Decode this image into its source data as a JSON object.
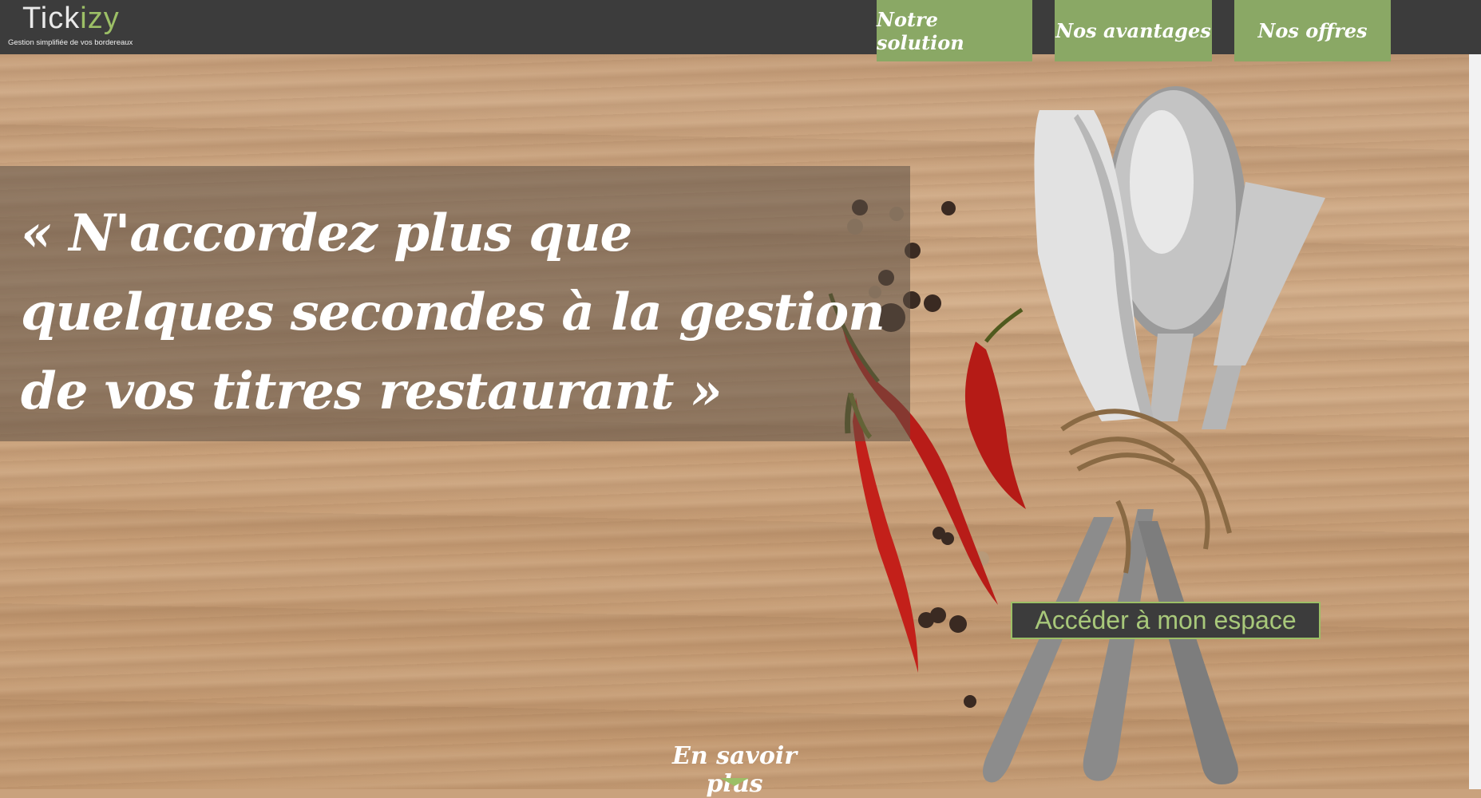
{
  "header": {
    "logo_main": "Tick",
    "logo_accent": "izy",
    "tagline": "Gestion simplifiée de vos bordereaux"
  },
  "nav": {
    "items": [
      "Notre solution",
      "Nos avantages",
      "Nos offres"
    ]
  },
  "hero": {
    "quote": "« N'accordez plus que quelques secondes à la gestion de vos titres restaurant »",
    "access_button": "Accéder à mon espace",
    "more_link": "En savoir plus"
  },
  "colors": {
    "accent": "#8aa865",
    "header_bg": "#3c3c3c",
    "chili": "#c8201c"
  }
}
